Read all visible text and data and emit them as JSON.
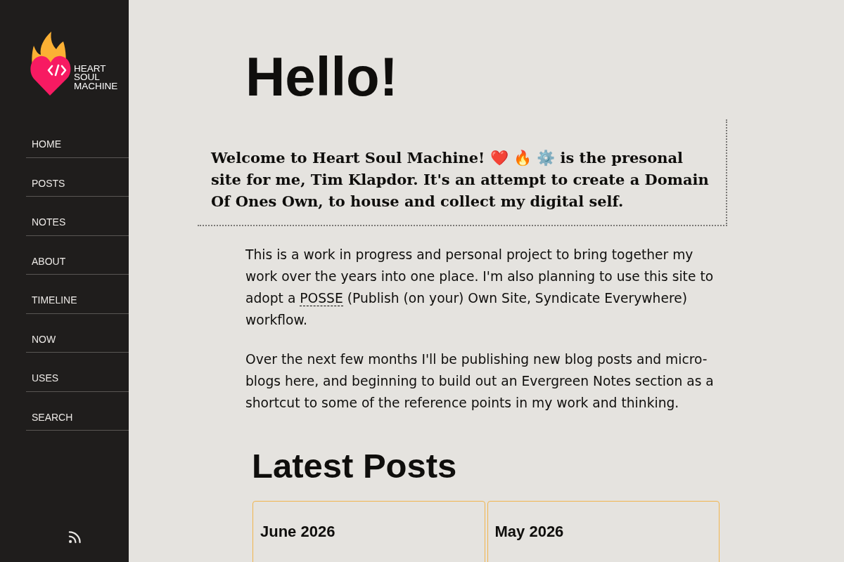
{
  "sidebar": {
    "logo_text": "HEART SOUL MACHINE",
    "nav": [
      {
        "label": "HOME"
      },
      {
        "label": "POSTS"
      },
      {
        "label": "NOTES"
      },
      {
        "label": "ABOUT"
      },
      {
        "label": "TIMELINE"
      },
      {
        "label": "NOW"
      },
      {
        "label": "USES"
      },
      {
        "label": "SEARCH"
      }
    ]
  },
  "main": {
    "title": "Hello!",
    "intro": "Welcome to Heart Soul Machine! ❤️ 🔥 ⚙️ is the presonal site for me, Tim Klapdor. It's an attempt to create a Domain Of Ones Own, to house and collect my digital self.",
    "paragraphs": [
      {
        "parts": [
          {
            "kind": "text",
            "text": "This is a work in progress and personal project to bring together my work over the years into one place. I'm also planning to use this site to adopt a "
          },
          {
            "kind": "abbr",
            "text": "POSSE"
          },
          {
            "kind": "text",
            "text": " (Publish (on your) Own Site, Syndicate Everywhere) workflow."
          }
        ]
      },
      {
        "parts": [
          {
            "kind": "text",
            "text": "Over the next few months I'll be publishing new blog posts and micro-blogs here, and beginning to build out an Evergreen Notes section as a shortcut to some of the reference points in my work and thinking."
          }
        ]
      }
    ],
    "latest_posts": {
      "heading": "Latest Posts",
      "cards": [
        {
          "title": "June 2026"
        },
        {
          "title": "May 2026"
        }
      ]
    }
  }
}
